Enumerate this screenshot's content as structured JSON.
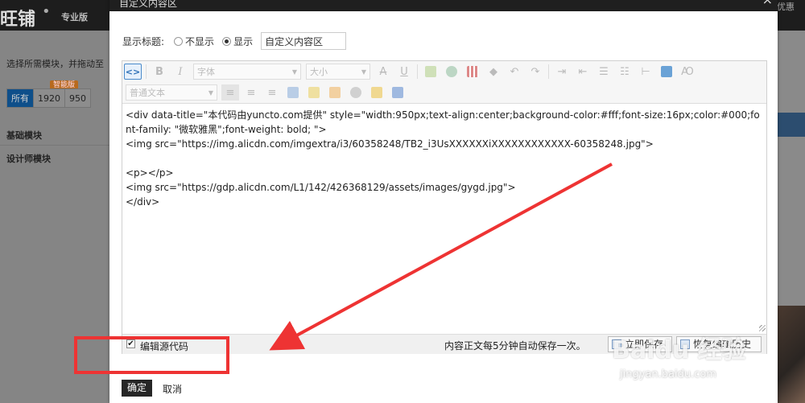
{
  "background": {
    "logo": "旺铺",
    "edition": "专业版",
    "hint": "选择所需模块，并拖动至",
    "badge": "智能版",
    "tabs": [
      "所有",
      "1920",
      "950"
    ],
    "categories": [
      "基础模块",
      "设计师模块"
    ],
    "top_right": "优惠"
  },
  "dialog": {
    "title": "自定义内容区",
    "close": "×",
    "show_title_label": "显示标题:",
    "options": [
      "不显示",
      "显示"
    ],
    "selected_option": "显示",
    "title_input_value": "自定义内容区"
  },
  "editor": {
    "toolbar": {
      "source_button": "<>",
      "font_select": "字体",
      "size_select": "大小",
      "paragraph_select": "普通文本"
    },
    "source_lines": [
      "<div data-title=\"本代码由yuncto.com提供\" style=\"width:950px;text-align:center;background-color:#fff;font-size:16px;color:#000;font-family: \"微软雅黑\";font-weight: bold; \">",
      "<img src=\"https://img.alicdn.com/imgextra/i3/60358248/TB2_i3UsXXXXXXiXXXXXXXXXXXX-60358248.jpg\">",
      "",
      "<p></p>",
      "<img src=\"https://gdp.alicdn.com/L1/142/426368129/assets/images/gygd.jpg\">",
      "</div>"
    ],
    "footer": {
      "edit_source_label": "编辑源代码",
      "edit_source_checked": true,
      "autosave_text": "内容正文每5分钟自动保存一次。",
      "save_now_button": "立即保存",
      "history_button": "恢复编辑历史"
    }
  },
  "actions": {
    "ok": "确定",
    "cancel": "取消"
  },
  "watermark": {
    "main": "Baidu 经验",
    "sub": "jingyan.baidu.com"
  },
  "colors": {
    "annotation": "#ee3333",
    "titlebar": "#1f1f1f",
    "ok_button": "#262626"
  }
}
